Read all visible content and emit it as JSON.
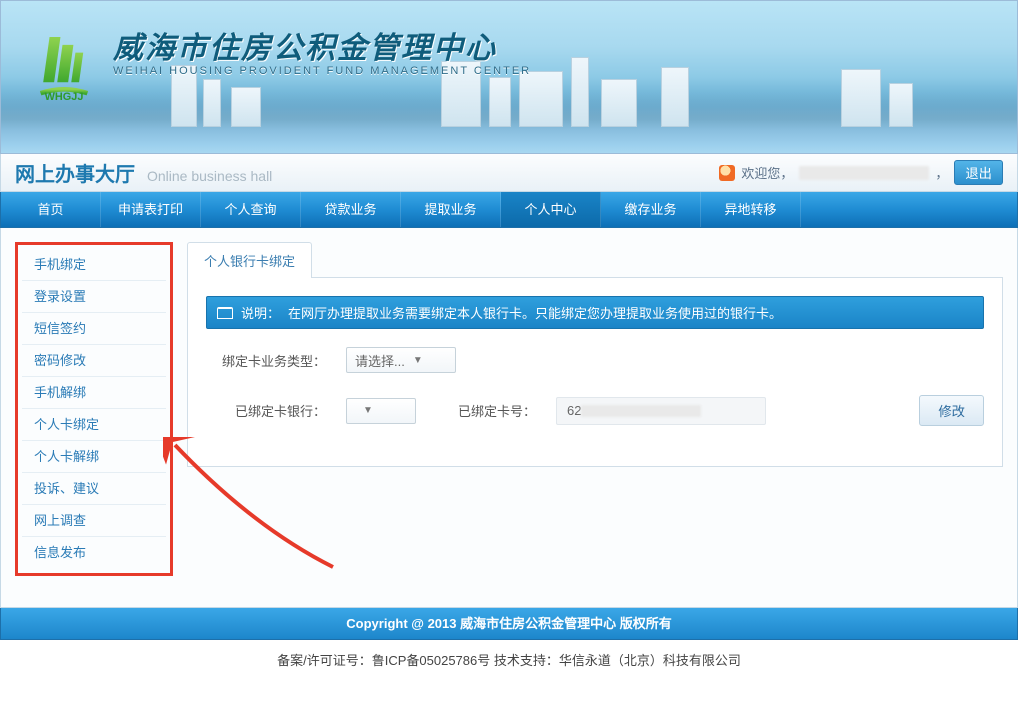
{
  "banner": {
    "title_cn": "威海市住房公积金管理中心",
    "title_en": "WEIHAI HOUSING PROVIDENT FUND MANAGEMENT CENTER",
    "logo_code": "WHGJJ"
  },
  "topbar": {
    "hall_title": "网上办事大厅",
    "hall_sub": "Online business hall",
    "welcome": "欢迎您，",
    "logout": "退出"
  },
  "nav": {
    "items": [
      "首页",
      "申请表打印",
      "个人查询",
      "贷款业务",
      "提取业务",
      "个人中心",
      "缴存业务",
      "异地转移"
    ],
    "active_index": 5
  },
  "sidebar": {
    "items": [
      "手机绑定",
      "登录设置",
      "短信签约",
      "密码修改",
      "手机解绑",
      "个人卡绑定",
      "个人卡解绑",
      "投诉、建议",
      "网上调查",
      "信息发布"
    ],
    "highlight_index": 5
  },
  "main": {
    "tab_label": "个人银行卡绑定",
    "notice_prefix": "说明：",
    "notice_text": "在网厅办理提取业务需要绑定本人银行卡。只能绑定您办理提取业务使用过的银行卡。",
    "form": {
      "biz_type_label": "绑定卡业务类型：",
      "biz_type_placeholder": "请选择...",
      "bank_label": "已绑定卡银行：",
      "bank_value": "",
      "cardno_label": "已绑定卡号：",
      "cardno_prefix": "62",
      "modify_btn": "修改"
    }
  },
  "footer": {
    "copyright": "Copyright @ 2013 威海市住房公积金管理中心 版权所有",
    "record": "备案/许可证号：鲁ICP备05025786号 技术支持：华信永道（北京）科技有限公司"
  }
}
